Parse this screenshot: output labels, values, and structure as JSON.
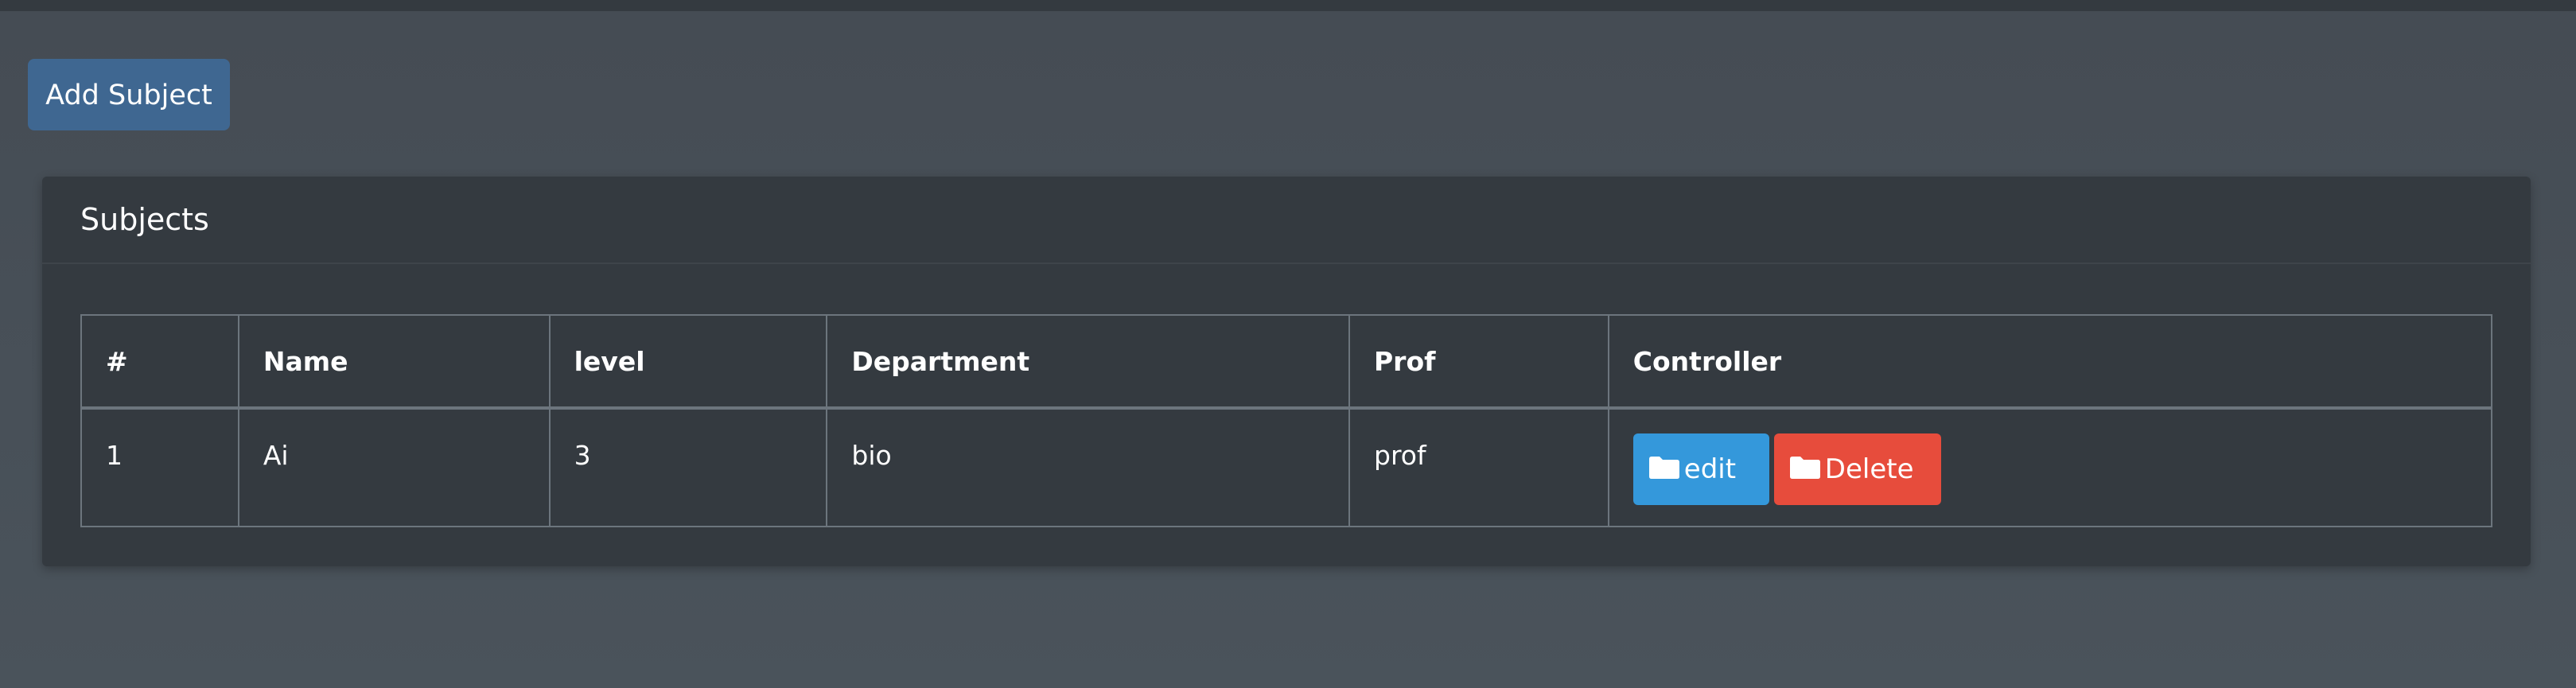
{
  "toolbar": {
    "add_label": "Add Subject"
  },
  "card": {
    "title": "Subjects"
  },
  "table": {
    "columns": [
      "#",
      "Name",
      "level",
      "Department",
      "Prof",
      "Controller"
    ],
    "rows": [
      {
        "num": "1",
        "name": "Ai",
        "level": "3",
        "department": "bio",
        "prof": "prof",
        "edit_label": "edit",
        "delete_label": "Delete"
      }
    ]
  },
  "icons": {
    "edit": "folder-icon",
    "delete": "folder-icon"
  },
  "colors": {
    "page_bg": "#454d55",
    "card_bg": "#343a40",
    "add_button": "#3f6791",
    "edit_button": "#3498db",
    "delete_button": "#e74c3c",
    "table_border": "#6c757d"
  }
}
